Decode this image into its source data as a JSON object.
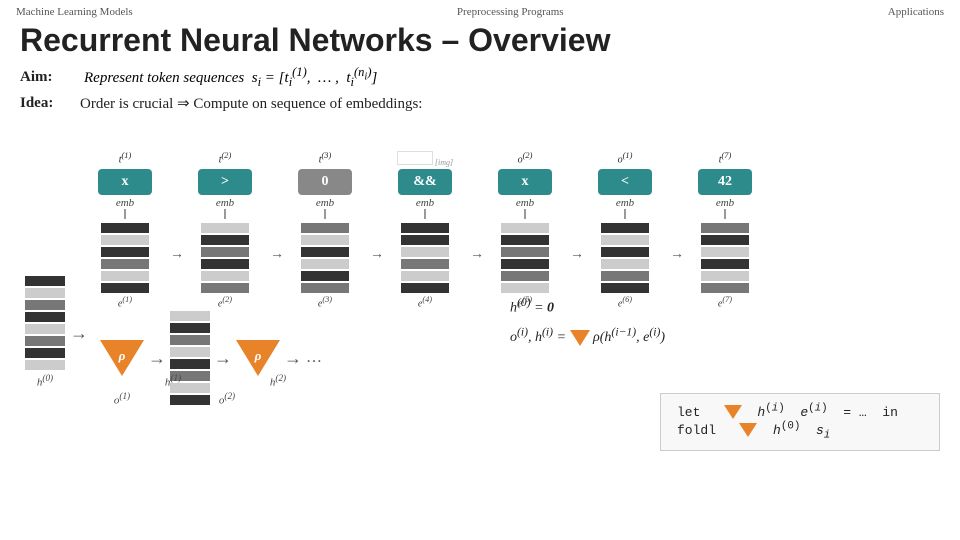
{
  "header": {
    "left": "Machine Learning Models",
    "center": "Preprocessing Programs",
    "right": "Applications"
  },
  "title": "Recurrent Neural Networks – Overview",
  "aim": {
    "label": "Aim:",
    "text": "Represent token sequences"
  },
  "idea": {
    "label": "Idea:",
    "text": "Order is crucial ⇒ Compute on sequence of embeddings:"
  },
  "tokens": [
    {
      "sup": "t⁽¹⁾",
      "label": "x",
      "color": "teal",
      "emb": "emb"
    },
    {
      "sup": "t⁽²⁾",
      "label": ">",
      "color": "teal",
      "emb": "emb"
    },
    {
      "sup": "t⁽³⁾",
      "label": "0",
      "color": "gray",
      "emb": "emb"
    },
    {
      "sup": "",
      "label": "&&",
      "color": "teal",
      "emb": "emb"
    },
    {
      "sup": "o⁽²⁾",
      "label": "x",
      "color": "teal",
      "emb": "emb"
    },
    {
      "sup": "o⁽¹⁾",
      "label": "<",
      "color": "teal",
      "emb": "emb"
    },
    {
      "sup": "t⁽⁷⁾",
      "label": "42",
      "color": "teal",
      "emb": "emb"
    }
  ],
  "h_labels": [
    "h⁽⁰⁾",
    "h⁽¹⁾",
    "h⁽²⁾"
  ],
  "o_labels": [
    "o⁽¹⁾",
    "o⁽²⁾"
  ],
  "formula1": "h⁽⁰⁾ = 0",
  "formula2": "o⁽ⁱ⁾, h⁽ⁱ⁾ = ρ(h⁽ⁱ⁻¹⁾, e⁽ⁱ⁾)",
  "code_line1": "let ρ  h⁽ⁱ⁾  e⁽ⁱ⁾  = …  in",
  "code_line2": "foldl  ρ  h⁽⁰⁾  sᵢ"
}
